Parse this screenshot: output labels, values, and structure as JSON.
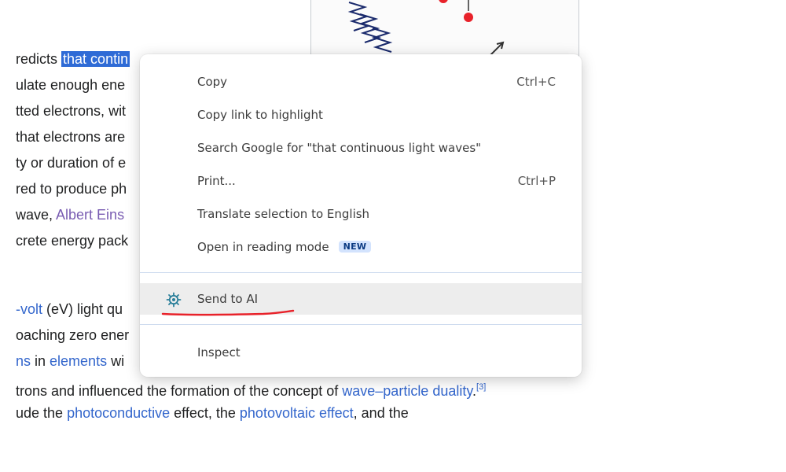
{
  "article": {
    "lines": [
      {
        "pre": "redicts ",
        "selected": "that contin",
        "rest": ""
      },
      {
        "pre": "ulate enough ene"
      },
      {
        "pre": "tted electrons, wit"
      },
      {
        "pre": " that electrons are"
      },
      {
        "pre": "ty or duration of e"
      },
      {
        "pre": "red to produce ph"
      },
      {
        "pre": " wave, ",
        "link": "Albert Eins"
      },
      {
        "pre": "crete energy pack"
      },
      {
        "link": "-volt",
        "post": " (eV) light qu"
      },
      {
        "pre": "oaching zero ener"
      },
      {
        "link": "ns",
        "post": " in ",
        "link2": "elements",
        "post2": " wi"
      },
      {
        "pre": "trons and influenced the formation of the concept of ",
        "link": "wave–particle duality",
        "post": ".",
        "sup": "[3]"
      },
      {
        "pre": "ude the ",
        "link": "photoconductive",
        "post": " effect, the ",
        "link2": "photovoltaic effect",
        "post2": ", and the"
      }
    ]
  },
  "context_menu": {
    "copy": {
      "label": "Copy",
      "shortcut": "Ctrl+C"
    },
    "copy_link": {
      "label": "Copy link to highlight"
    },
    "search": {
      "label": "Search Google for \"that continuous light waves\""
    },
    "print": {
      "label": "Print...",
      "shortcut": "Ctrl+P"
    },
    "translate": {
      "label": "Translate selection to English"
    },
    "reading_mode": {
      "label": "Open in reading mode",
      "badge": "NEW"
    },
    "send_to_ai": {
      "label": "Send to AI",
      "icon": "gear-bug-icon"
    },
    "inspect": {
      "label": "Inspect"
    }
  },
  "colors": {
    "selection": "#2f6bd6",
    "link": "#3366cc",
    "visited_link": "#795cb2",
    "annotation": "#e8222a",
    "hover": "#ededed"
  }
}
